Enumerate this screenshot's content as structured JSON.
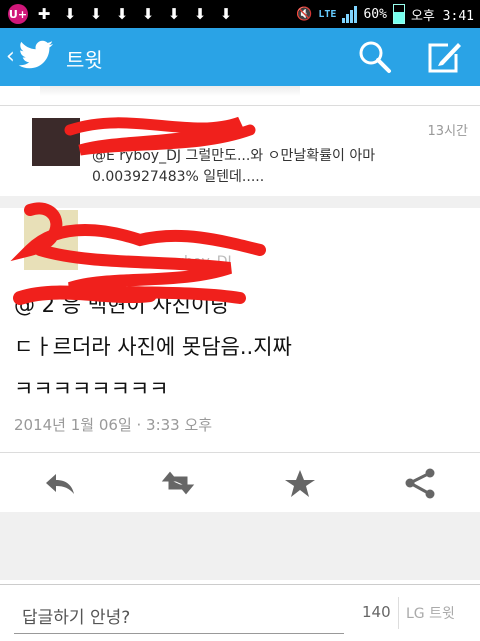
{
  "status_bar": {
    "left_icons": [
      "uplus-icon",
      "plus-notification-icon",
      "download-icon",
      "download-icon",
      "download-icon",
      "download-icon",
      "download-icon",
      "download-icon",
      "download-icon"
    ],
    "battery_percent": "60%",
    "time": "오후 3:41",
    "network": "LTE"
  },
  "app_bar": {
    "title": "트윗",
    "accent": "#2aa3e6"
  },
  "previous_tweet": {
    "time": "13시간",
    "text_line1": "@E            ryboy_DJ 그럴만도...와 ㅇ만날확률이 아마",
    "text_line2": "0.003927483% 일텐데....."
  },
  "main_tweet": {
    "line1": "@         2 응 백현이 사진이랑",
    "line2": "ㄷㅏ르더라 사진에 못담음..지짜",
    "line3": "ㅋㅋㅋㅋㅋㅋㅋㅋ",
    "date": "2014년 1월 06일 · 3:33 오후",
    "handle_fragment": "ryboy_DJ"
  },
  "actions": [
    "reply-icon",
    "retweet-icon",
    "favorite-icon",
    "share-icon"
  ],
  "reply_bar": {
    "placeholder": "답글하기 안녕?",
    "char_count": "140",
    "button": "LG 트윗"
  }
}
